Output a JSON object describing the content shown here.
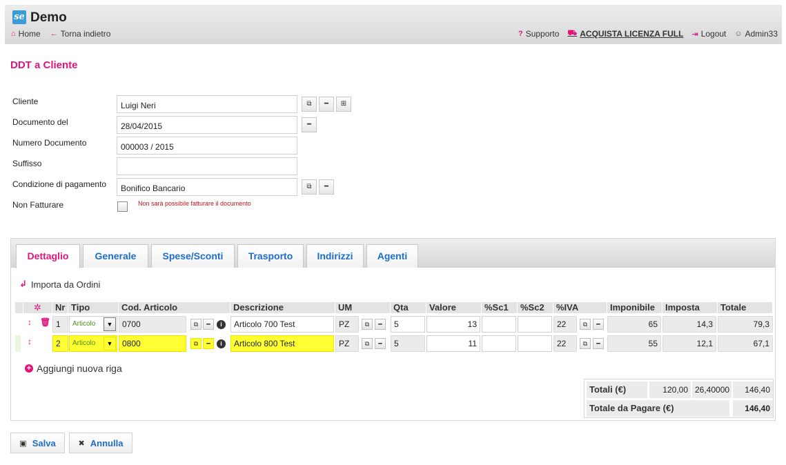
{
  "app": {
    "logo_text": "se",
    "title": "Demo"
  },
  "nav_left": [
    {
      "icon": "⌂",
      "label": "Home"
    },
    {
      "icon": "←",
      "label": "Torna indietro"
    }
  ],
  "nav_right": [
    {
      "icon": "?",
      "label": "Supporto"
    },
    {
      "icon": "⛟",
      "label": "ACQUISTA LICENZA FULL"
    },
    {
      "icon": "⇥",
      "label": "Logout"
    },
    {
      "icon": "☺",
      "label": "Admin33"
    }
  ],
  "page_title": "DDT a Cliente",
  "form": {
    "cliente": {
      "label": "Cliente",
      "value": "Luigi Neri"
    },
    "documento_del": {
      "label": "Documento del",
      "value": "28/04/2015"
    },
    "numero_documento": {
      "label": "Numero Documento",
      "value": "000003 / 2015"
    },
    "suffisso": {
      "label": "Suffisso",
      "value": ""
    },
    "condizione_pagamento": {
      "label": "Condizione di pagamento",
      "value": "Bonifico Bancario"
    },
    "non_fatturare": {
      "label": "Non Fatturare",
      "note": "Non sarà possibile fatturare il documento",
      "checked": false
    }
  },
  "tabs": [
    "Dettaglio",
    "Generale",
    "Spese/Sconti",
    "Trasporto",
    "Indirizzi",
    "Agenti"
  ],
  "import_label": "Importa da Ordini",
  "grid": {
    "headers": {
      "nr": "Nr",
      "tipo": "Tipo",
      "cod": "Cod. Articolo",
      "desc": "Descrizione",
      "um": "UM",
      "qta": "Qta",
      "valore": "Valore",
      "sc1": "%Sc1",
      "sc2": "%Sc2",
      "iva": "%IVA",
      "imponibile": "Imponibile",
      "imposta": "Imposta",
      "totale": "Totale"
    },
    "rows": [
      {
        "nr": "1",
        "tipo": "Articolo",
        "cod": "0700",
        "desc": "Articolo 700 Test",
        "um": "PZ",
        "qta": "5",
        "valore": "13",
        "sc1": "",
        "sc2": "",
        "iva": "22",
        "imponibile": "65",
        "imposta": "14,3",
        "totale": "79,3"
      },
      {
        "nr": "2",
        "tipo": "Articolo",
        "cod": "0800",
        "desc": "Articolo 800 Test",
        "um": "PZ",
        "qta": "5",
        "valore": "11",
        "sc1": "",
        "sc2": "",
        "iva": "22",
        "imponibile": "55",
        "imposta": "12,1",
        "totale": "67,1"
      }
    ]
  },
  "add_row_label": "Aggiungi nuova riga",
  "totals": {
    "totali_label": "Totali (€)",
    "imponibile": "120,00",
    "imposta": "26,40000",
    "totale": "146,40",
    "da_pagare_label": "Totale da Pagare (€)",
    "da_pagare": "146,40"
  },
  "buttons": {
    "save": "Salva",
    "cancel": "Annulla"
  },
  "colors": {
    "accent": "#e0157a",
    "link": "#1e6ec9",
    "highlight": "#ffff33"
  }
}
